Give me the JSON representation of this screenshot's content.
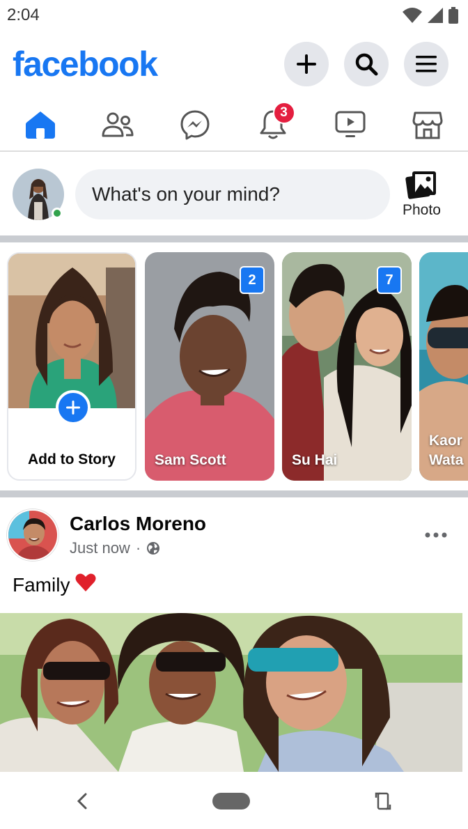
{
  "status_bar": {
    "time": "2:04"
  },
  "header": {
    "logo": "facebook",
    "buttons": [
      "plus-icon",
      "search-icon",
      "menu-icon"
    ]
  },
  "tabs": [
    {
      "name": "home",
      "icon": "home-icon",
      "active": true
    },
    {
      "name": "friends",
      "icon": "friends-icon"
    },
    {
      "name": "messenger",
      "icon": "messenger-icon"
    },
    {
      "name": "notifications",
      "icon": "bell-icon",
      "badge": "3"
    },
    {
      "name": "watch",
      "icon": "video-icon"
    },
    {
      "name": "marketplace",
      "icon": "store-icon"
    }
  ],
  "composer": {
    "placeholder": "What's on your mind?",
    "photo_label": "Photo"
  },
  "stories": {
    "add_label": "Add to Story",
    "items": [
      {
        "name": "Sam Scott",
        "count": "2"
      },
      {
        "name": "Su Hai",
        "count": "7"
      },
      {
        "name": "Kaor\nWata"
      }
    ]
  },
  "post": {
    "author": "Carlos Moreno",
    "time": "Just now",
    "separator": "·",
    "privacy_icon": "globe-icon",
    "text": "Family",
    "emoji": "❤️"
  },
  "colors": {
    "brand": "#1877f2",
    "badge": "#e41e3f",
    "online": "#31a24c"
  }
}
